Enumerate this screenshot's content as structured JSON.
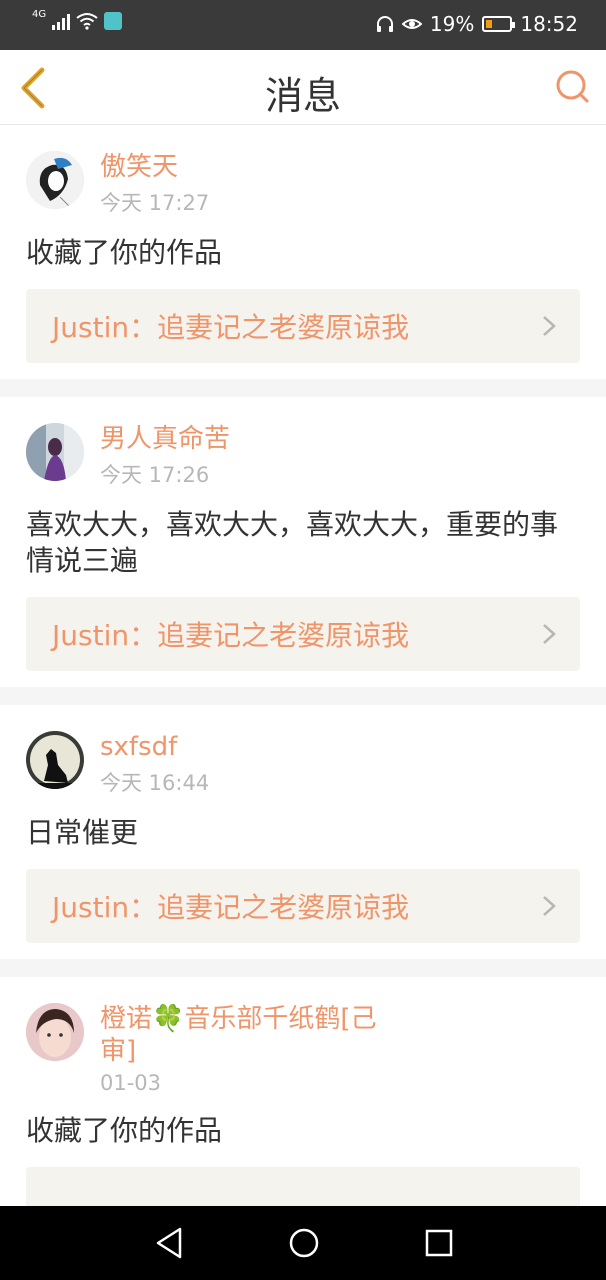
{
  "status_bar": {
    "network": "4G",
    "battery_percent": "19%",
    "battery_level": 0.19,
    "time": "18:52"
  },
  "header": {
    "title": "消息"
  },
  "messages": [
    {
      "user": "傲笑天",
      "time": "今天 17:27",
      "content": "收藏了你的作品",
      "work": "Justin：追妻记之老婆原谅我"
    },
    {
      "user": "男人真命苦",
      "time": "今天 17:26",
      "content": "喜欢大大，喜欢大大，喜欢大大，重要的事情说三遍",
      "work": "Justin：追妻记之老婆原谅我"
    },
    {
      "user": "sxfsdf",
      "time": "今天 16:44",
      "content": "日常催更",
      "work": "Justin：追妻记之老婆原谅我"
    },
    {
      "user": "橙诺🍀音乐部千纸鹤[己审]",
      "time": "01-03",
      "content": "收藏了你的作品",
      "work": ""
    }
  ],
  "colors": {
    "accent": "#f0956a",
    "status_bar": "#3a3a3a",
    "work_bg": "#f4f3ee"
  }
}
